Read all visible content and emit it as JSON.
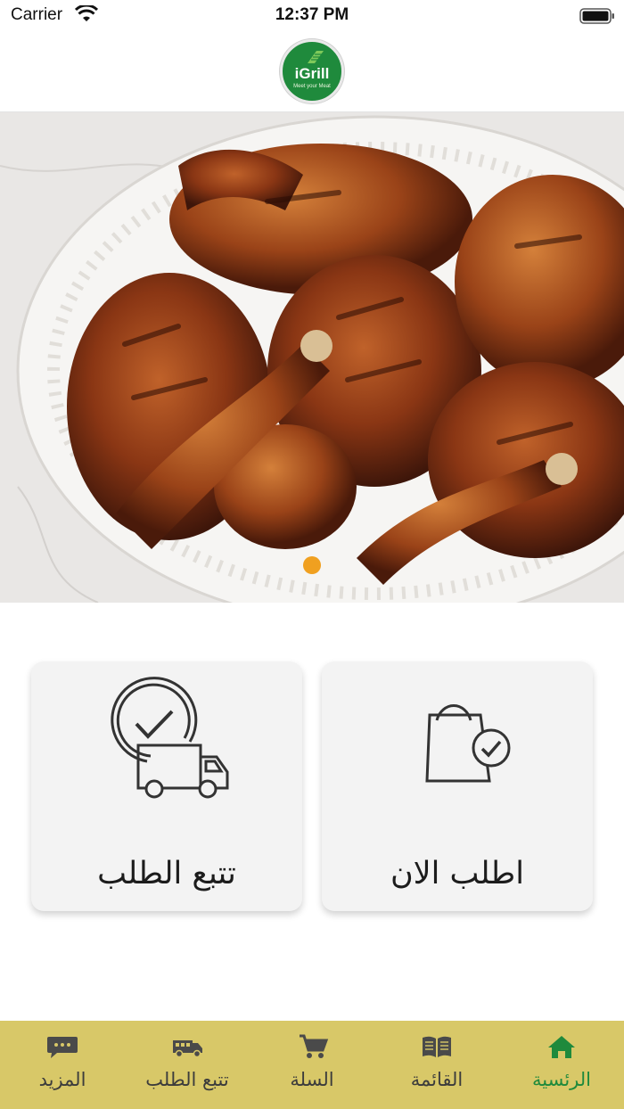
{
  "status_bar": {
    "carrier": "Carrier",
    "time": "12:37 PM"
  },
  "header": {
    "logo_text": "iGrill",
    "logo_tagline": "Meet your Meat",
    "logo_color": "#1f8a3c"
  },
  "hero": {
    "image": "grilled-chicken-platter",
    "carousel_pages": 1,
    "active_page": 1,
    "indicator_color": "#f0a020"
  },
  "actions": [
    {
      "label": "تتبع الطلب",
      "icon": "delivery-truck-clock-icon"
    },
    {
      "label": "اطلب الان",
      "icon": "shopping-bag-check-icon"
    }
  ],
  "tabbar": {
    "background": "#d8c868",
    "active_color": "#1f8a3c",
    "items": [
      {
        "label": "المزيد",
        "icon": "more-chat-icon"
      },
      {
        "label": "تتبع الطلب",
        "icon": "delivery-van-icon"
      },
      {
        "label": "السلة",
        "icon": "cart-icon"
      },
      {
        "label": "القائمة",
        "icon": "menu-book-icon"
      },
      {
        "label": "الرئسية",
        "icon": "home-icon",
        "active": true
      }
    ]
  }
}
